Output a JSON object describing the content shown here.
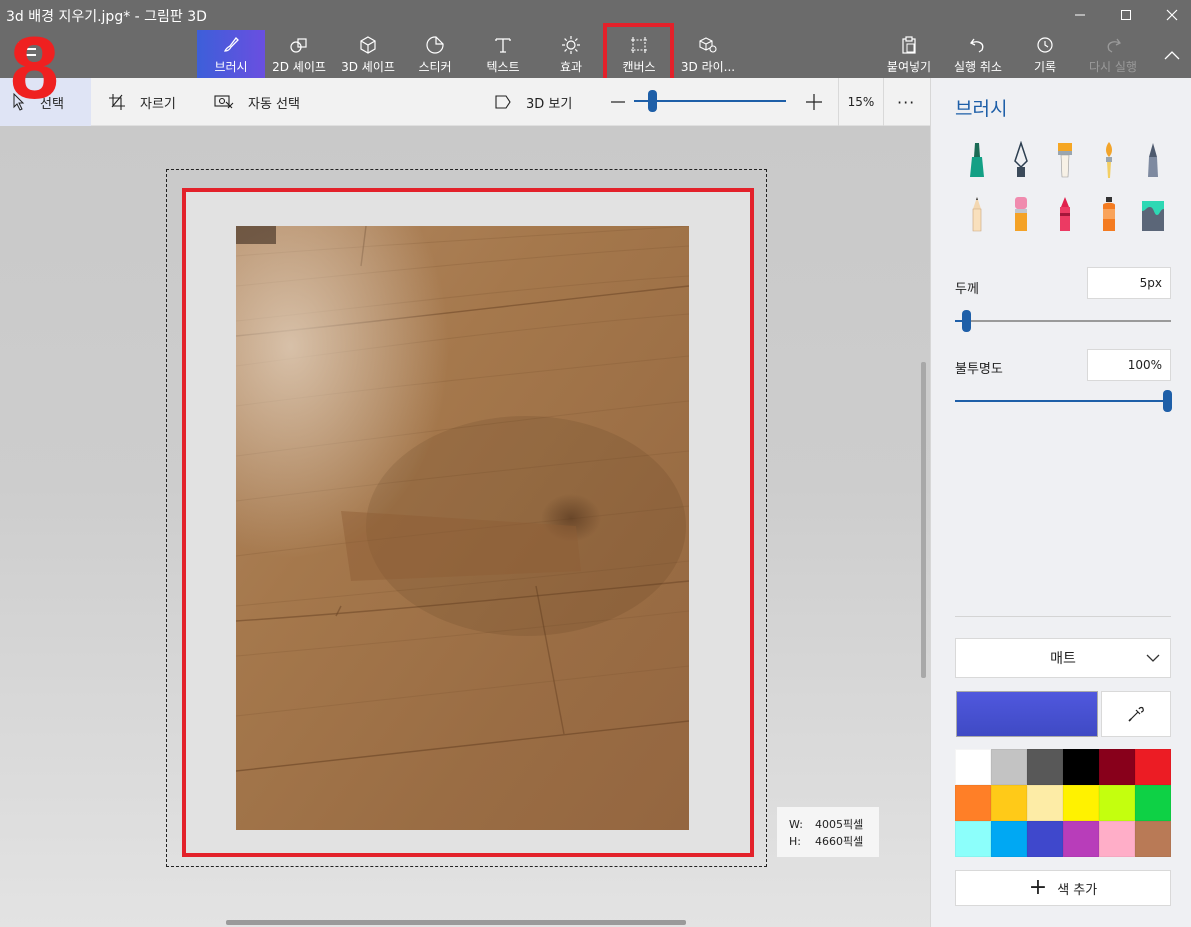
{
  "window": {
    "title": "3d 배경 지우기.jpg* - 그림판 3D",
    "minimize_icon": "minimize-icon",
    "maximize_icon": "maximize-icon",
    "close_icon": "close-icon"
  },
  "overlay": {
    "step_number": "8"
  },
  "toolbar": {
    "tools": [
      {
        "label": "브러시",
        "icon": "brush-icon",
        "active": true
      },
      {
        "label": "2D 셰이프",
        "icon": "2d-shapes-icon"
      },
      {
        "label": "3D 셰이프",
        "icon": "3d-shapes-icon"
      },
      {
        "label": "스티커",
        "icon": "sticker-icon"
      },
      {
        "label": "텍스트",
        "icon": "text-icon"
      },
      {
        "label": "효과",
        "icon": "effects-icon"
      },
      {
        "label": "캔버스",
        "icon": "canvas-icon",
        "highlighted": true
      },
      {
        "label": "3D 라이...",
        "icon": "3d-library-icon"
      }
    ],
    "actions": [
      {
        "label": "붙여넣기",
        "icon": "paste-icon"
      },
      {
        "label": "실행 취소",
        "icon": "undo-icon"
      },
      {
        "label": "기록",
        "icon": "history-icon"
      },
      {
        "label": "다시 실행",
        "icon": "redo-icon",
        "disabled": true
      }
    ]
  },
  "subtoolbar": {
    "select_label": "선택",
    "crop_label": "자르기",
    "magic_select_label": "자동 선택",
    "view3d_label": "3D 보기",
    "zoom_percent": "15%",
    "zoom_level": 0.15,
    "more_label": "···"
  },
  "canvas": {
    "width_label": "W:",
    "width_value": "4005픽셀",
    "height_label": "H:",
    "height_value": "4660픽셀"
  },
  "panel": {
    "title": "브러시",
    "brushes": [
      "marker-icon",
      "calligraphy-pen-icon",
      "oil-brush-icon",
      "watercolor-icon",
      "pixel-pen-icon",
      "pencil-icon",
      "eraser-icon",
      "crayon-icon",
      "spray-can-icon",
      "fill-icon"
    ],
    "thickness_label": "두께",
    "thickness_value": "5px",
    "opacity_label": "불투명도",
    "opacity_value": "100%",
    "finish": "매트",
    "current_color": "#3f4ac4",
    "palette": [
      "#ffffff",
      "#c3c3c3",
      "#585858",
      "#000000",
      "#88001b",
      "#ec1c24",
      "#ff7f27",
      "#ffca18",
      "#fdeca6",
      "#fff200",
      "#c4ff0e",
      "#0ed145",
      "#8cfffb",
      "#00a8f3",
      "#3f48cc",
      "#b83dba",
      "#ffaec8",
      "#b97a56"
    ],
    "add_color_label": "색 추가"
  }
}
